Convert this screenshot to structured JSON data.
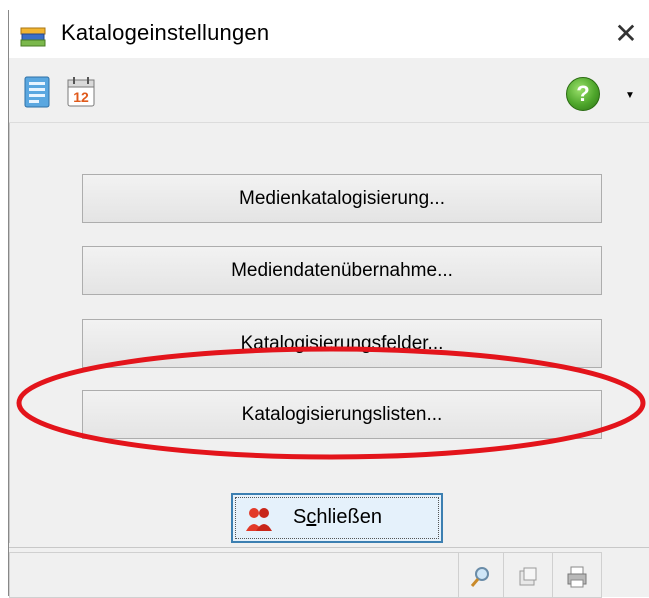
{
  "window": {
    "title": "Katalogeinstellungen",
    "close_glyph": "✕"
  },
  "toolbar": {
    "icons": [
      "catalog-icon",
      "calendar-icon"
    ],
    "calendar_number": "12",
    "help_glyph": "?"
  },
  "buttons": [
    {
      "label": "Medienkatalogisierung..."
    },
    {
      "label": "Mediendatenübernahme..."
    },
    {
      "label": "Katalogisierungsfelder..."
    },
    {
      "label": "Katalogisierungslisten..."
    }
  ],
  "close_button": {
    "label_prefix": "S",
    "label_mnemonic": "c",
    "label_suffix": "hließen"
  },
  "statusbar": {
    "icons": [
      "search-icon",
      "page-icon",
      "printer-icon"
    ]
  },
  "colors": {
    "annotation": "#e3141b",
    "help_green": "#4ea62b",
    "focus_blue": "#3c7fb1"
  }
}
